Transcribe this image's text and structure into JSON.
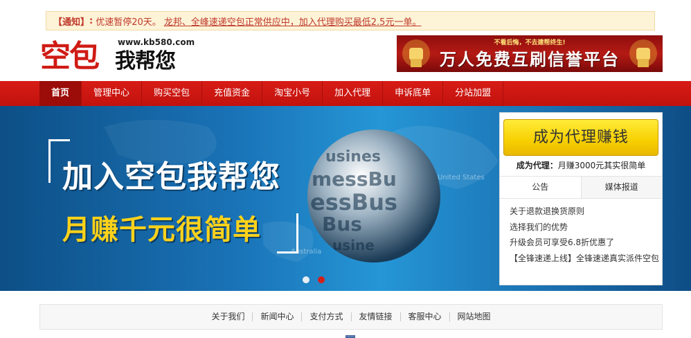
{
  "notice": {
    "tag": "【通知】",
    "separator": ":",
    "message_1": "优速暂停20天。",
    "message_2": "龙邦、全峰速递空包正常供应中，加入代理购买最低2.5元一单。"
  },
  "header": {
    "logo_main": "空包",
    "logo_sub": "我帮您",
    "logo_url": "www.kb580.com",
    "ad_top": "不看后悔，不去建帮终生!",
    "ad_main": "万人免费互刷信誉平台"
  },
  "nav": {
    "items": [
      {
        "label": "首页"
      },
      {
        "label": "管理中心"
      },
      {
        "label": "购买空包"
      },
      {
        "label": "充值资金"
      },
      {
        "label": "淘宝小号"
      },
      {
        "label": "加入代理"
      },
      {
        "label": "申诉底单"
      },
      {
        "label": "分站加盟"
      }
    ]
  },
  "hero": {
    "headline": "加入空包我帮您",
    "subline": "月赚千元很简单",
    "map_label_1": "United States",
    "map_label_2": "Australia",
    "slides_total": 2,
    "slide_active_index": 1
  },
  "panel": {
    "agent_button": "成为代理赚钱",
    "agent_label": "成为代理：",
    "agent_text": "月赚3000元其实很简单",
    "tabs": [
      {
        "label": "公告"
      },
      {
        "label": "媒体报道"
      }
    ],
    "news": [
      {
        "text": "关于退款退换货原则"
      },
      {
        "text": "选择我们的优势"
      },
      {
        "text": "升级会员可享受6.8折优惠了"
      },
      {
        "text": "【全锋速递上线】全锋速递真实派件空包"
      }
    ]
  },
  "footer": {
    "links": [
      {
        "label": "关于我们"
      },
      {
        "label": "新闻中心"
      },
      {
        "label": "支付方式"
      },
      {
        "label": "友情链接"
      },
      {
        "label": "客服中心"
      },
      {
        "label": "网站地图"
      }
    ]
  }
}
